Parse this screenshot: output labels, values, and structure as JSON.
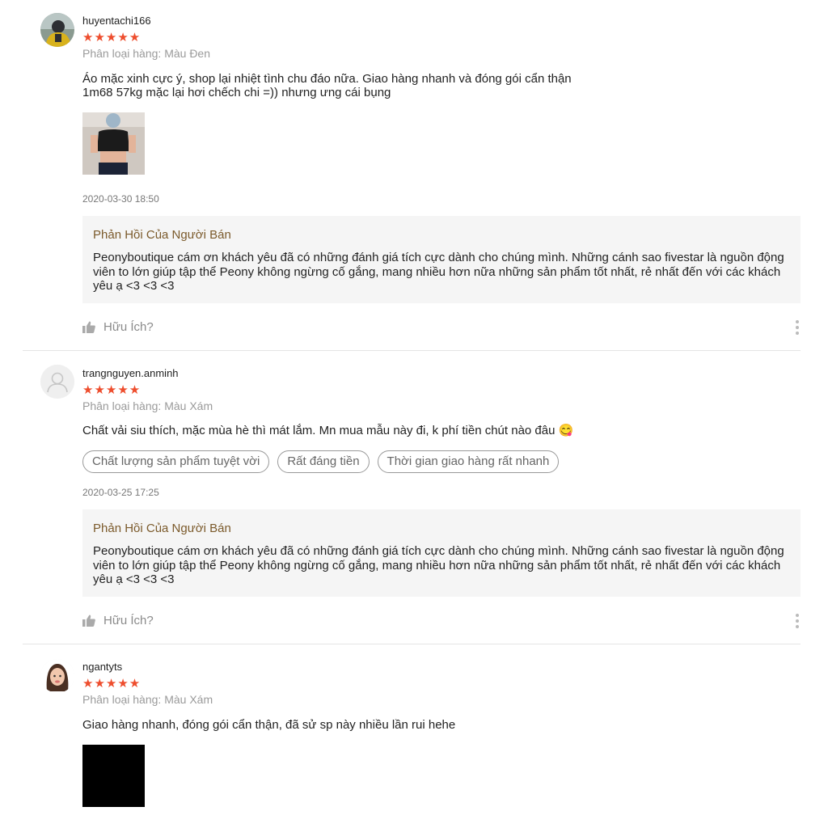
{
  "reviews": [
    {
      "username": "huyentachi166",
      "stars": "★★★★★",
      "variation": "Phân loại hàng: Màu Đen",
      "comment": "Áo mặc xinh cực ý, shop lại nhiệt tình chu đáo nữa. Giao hàng nhanh và đóng gói cẩn thận\n1m68 57kg mặc lại hơi chếch chi =)) nhưng ưng cái bụng",
      "date": "2020-03-30 18:50",
      "reply_title": "Phản Hồi Của Người Bán",
      "reply_text": "Peonyboutique cám ơn khách yêu đã có những đánh giá tích cực dành cho chúng mình. Những cánh sao fivestar là nguồn động viên to lớn giúp tập thể Peony không ngừng cố gắng, mang nhiều hơn nữa những sản phẩm tốt nhất, rẻ nhất đến với các khách yêu ạ <3 <3 <3",
      "helpful": "Hữu Ích?"
    },
    {
      "username": "trangnguyen.anminh",
      "stars": "★★★★★",
      "variation": "Phân loại hàng: Màu Xám",
      "comment": "Chất vải siu thích, mặc mùa hè thì mát lắm. Mn mua mẫu này đi, k phí tiền chút nào đâu 😋",
      "tags": [
        "Chất lượng sản phẩm tuyệt vời",
        "Rất đáng tiền",
        "Thời gian giao hàng rất nhanh"
      ],
      "date": "2020-03-25 17:25",
      "reply_title": "Phản Hồi Của Người Bán",
      "reply_text": "Peonyboutique cám ơn khách yêu đã có những đánh giá tích cực dành cho chúng mình. Những cánh sao fivestar là nguồn động viên to lớn giúp tập thể Peony không ngừng cố gắng, mang nhiều hơn nữa những sản phẩm tốt nhất, rẻ nhất đến với các khách yêu ạ <3 <3 <3",
      "helpful": "Hữu Ích?"
    },
    {
      "username": "ngantyts",
      "stars": "★★★★★",
      "variation": "Phân loại hàng: Màu Xám",
      "comment": "Giao hàng nhanh, đóng gói cẩn thận, đã sử sp này nhiều lần rui hehe"
    }
  ],
  "colors": {
    "star": "#ee4d2d",
    "reply_title": "#7b5a2b",
    "reply_bg": "#f5f5f5"
  },
  "icons": {
    "like": "thumbs-up-icon",
    "more": "more-vertical-icon",
    "default_avatar": "user-icon"
  }
}
